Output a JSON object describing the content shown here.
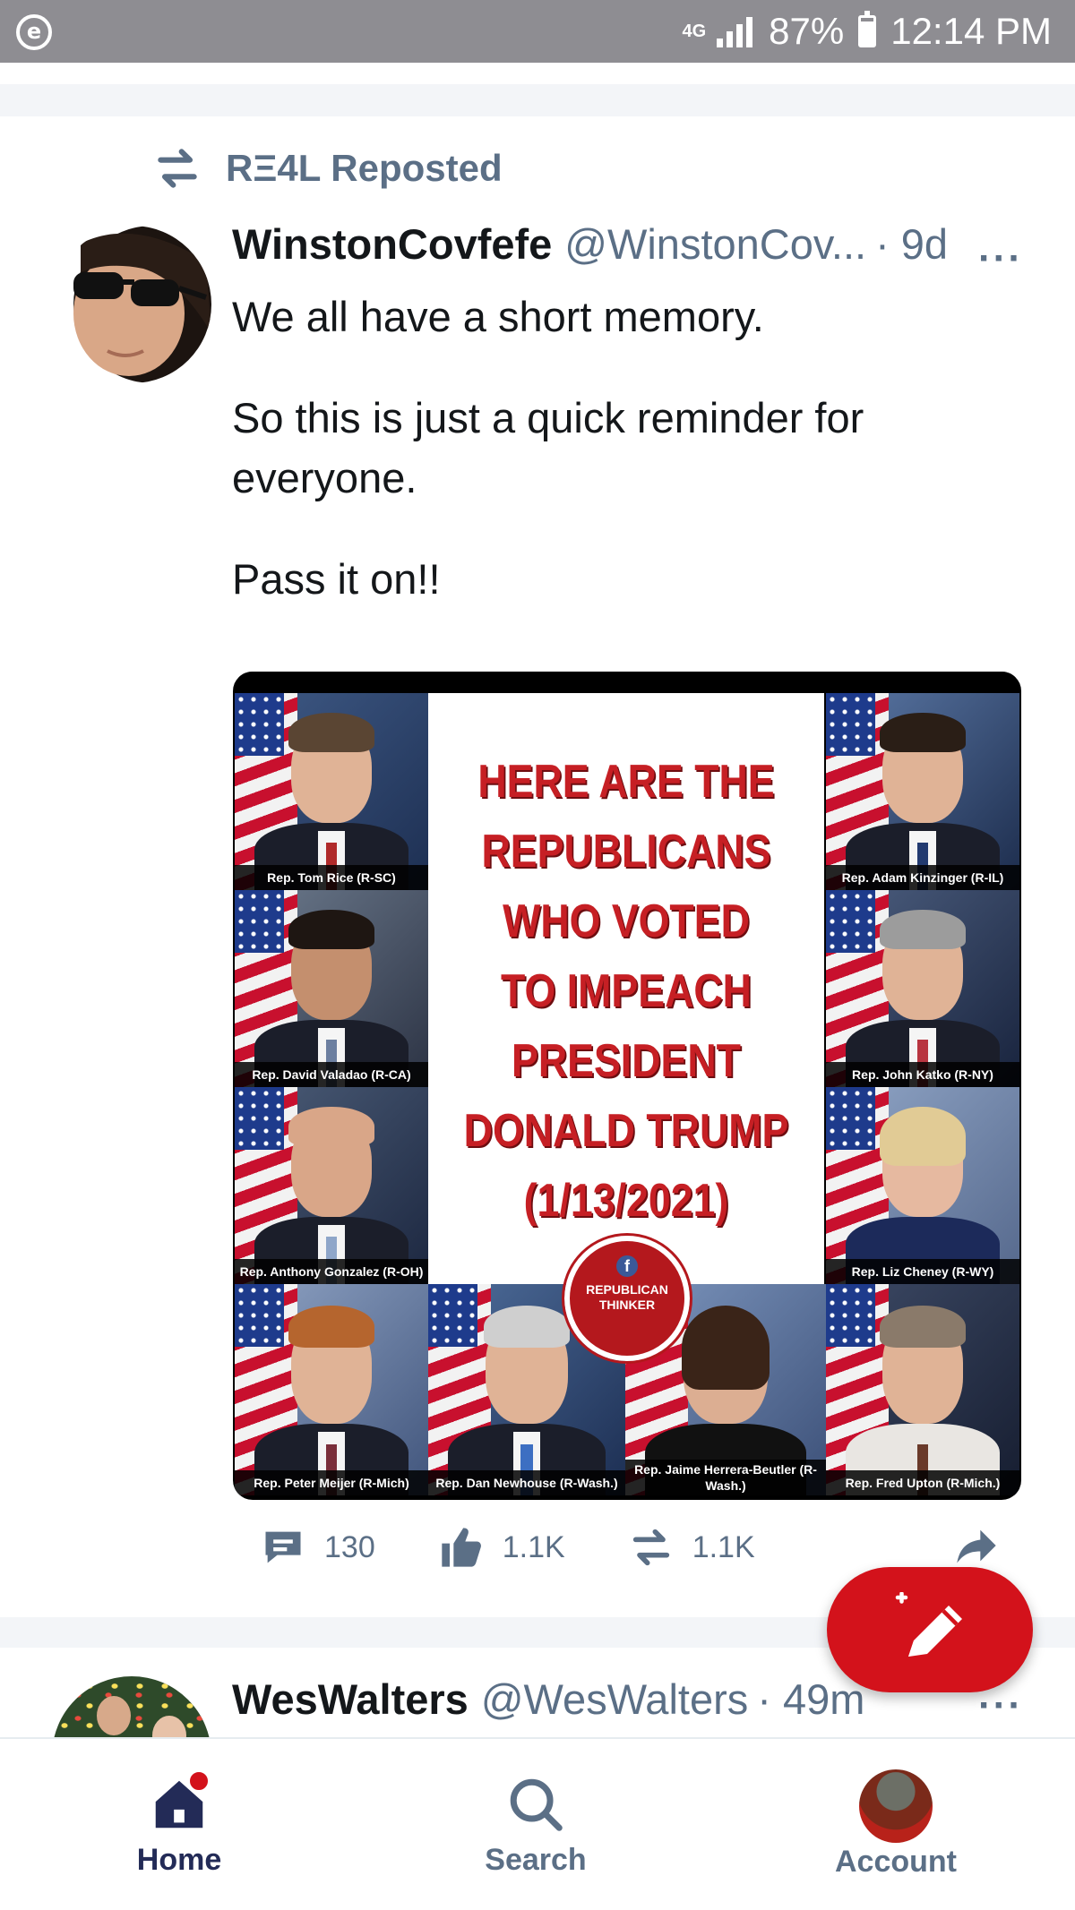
{
  "status_bar": {
    "app_icon": "e",
    "network": "4G",
    "battery": "87%",
    "time": "12:14 PM"
  },
  "post1": {
    "repost_label": "RΞ4L Reposted",
    "author": "WinstonCovfefe",
    "handle": "@WinstonCov...",
    "time": "· 9d",
    "more": "···",
    "paragraphs": [
      "We all have a short memory.",
      "So this is just a quick reminder for everyone.",
      "Pass it on!!"
    ],
    "image": {
      "headline_lines": [
        "HERE ARE THE",
        "REPUBLICANS",
        "WHO VOTED",
        "TO IMPEACH",
        "PRESIDENT",
        "DONALD TRUMP",
        "(1/13/2021)"
      ],
      "logo_line1": "REPUBLICAN",
      "logo_line2": "THINKER",
      "logo_f": "f",
      "captions": {
        "rice": "Rep. Tom Rice (R-SC)",
        "kinzinger": "Rep. Adam Kinzinger (R-IL)",
        "valadao": "Rep. David Valadao (R-CA)",
        "katko": "Rep. John Katko (R-NY)",
        "gonzalez": "Rep. Anthony Gonzalez (R-OH)",
        "cheney": "Rep. Liz Cheney (R-WY)",
        "meijer": "Rep. Peter Meijer (R-Mich)",
        "newhouse": "Rep. Dan Newhouse (R-Wash.)",
        "herrera": "Rep. Jaime Herrera-Beutler (R-Wash.)",
        "upton": "Rep. Fred Upton (R-Mich.)"
      }
    },
    "counts": {
      "replies": "130",
      "likes": "1.1K",
      "reposts": "1.1K"
    }
  },
  "post2": {
    "author": "WesWalters",
    "handle": "@WesWalters",
    "time": "· 49m",
    "more": "···"
  },
  "bottom_nav": {
    "home": "Home",
    "search": "Search",
    "account": "Account"
  },
  "colors": {
    "accent": "#d3121b",
    "muted_text": "#5b6f86",
    "nav_active": "#232b57",
    "status_bar": "#8e8d92"
  }
}
